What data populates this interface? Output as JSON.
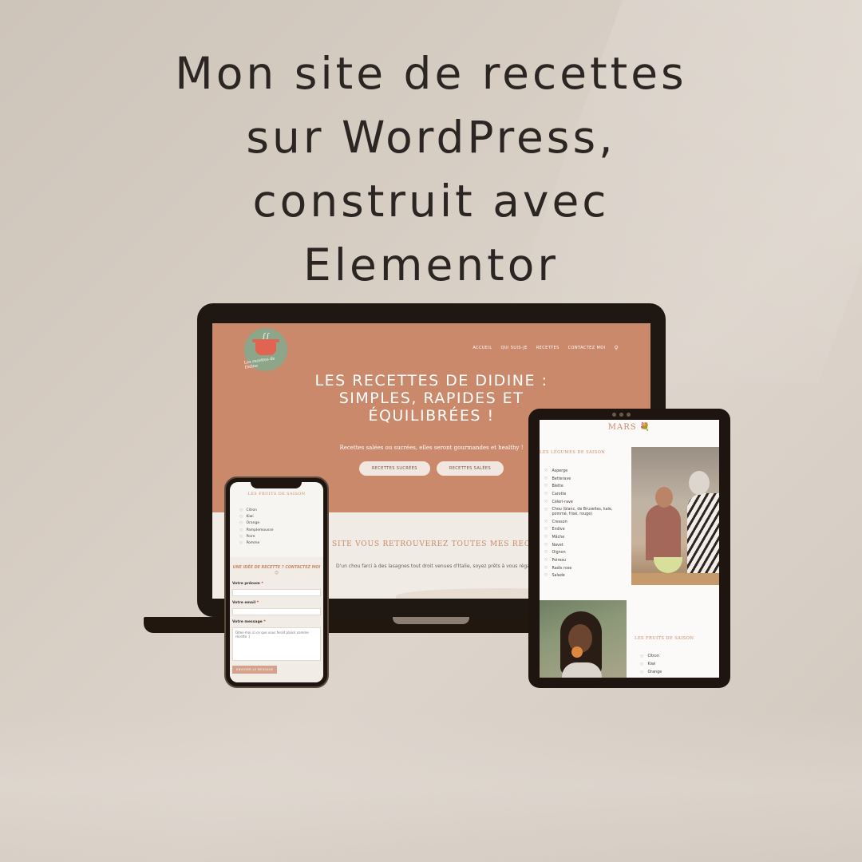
{
  "headline": {
    "line1": "Mon site de recettes",
    "line2": "sur WordPress,",
    "line3": "construit avec",
    "line4": "Elementor"
  },
  "colors": {
    "background": "#d6cdc3",
    "accent": "#c9896a",
    "logo_green": "#8da68a",
    "device_frame": "#1e1510"
  },
  "laptop": {
    "logo_label": "Les recettes de Didine",
    "nav": [
      "ACCUEIL",
      "QUI SUIS-JE",
      "RECETTES",
      "CONTACTEZ MOI"
    ],
    "search_icon": "search-icon",
    "hero_title": {
      "line1": "LES RECETTES DE DIDINE :",
      "line2": "SIMPLES, RAPIDES ET",
      "line3": "ÉQUILIBRÉES !"
    },
    "hero_subtitle": "Recettes salées ou sucrées, elles seront gourmandes et healthy !",
    "buttons": [
      "RECETTES SUCRÉES",
      "RECETTES SALÉES"
    ],
    "section_title": "SITE VOUS RETROUVEREZ TOUTES MES REC",
    "section_text": "D'un chou farci à des lasagnes tout droit venues d'Italie, soyez prêts à vous régaler !"
  },
  "phone": {
    "fruits_title": "LES FRUITS DE SAISON",
    "fruits": [
      "Citron",
      "Kiwi",
      "Orange",
      "Pamplemousse",
      "Poire",
      "Pomme"
    ],
    "contact_title": "UNE IDÉE DE RECETTE ? CONTACTEZ MOI 😊",
    "labels": {
      "first_name": "Votre prénom",
      "email": "Votre email",
      "message": "Votre message",
      "required": "*"
    },
    "message_placeholder": "Dites-moi ici ce que vous ferait plaisir comme recette :)",
    "submit": "ENVOYER LE MESSAGE"
  },
  "tablet": {
    "month": "MARS 💐",
    "vegetables_title": "LES LÉGUMES DE SAISON",
    "vegetables": [
      "Asperge",
      "Betterave",
      "Blette",
      "Carotte",
      "Céleri-rave",
      "Chou (blanc, de Bruxelles, kale, pommé, frisé, rouge)",
      "Cresson",
      "Endive",
      "Mâche",
      "Navet",
      "Oignon",
      "Poireau",
      "Radis rose",
      "Salade"
    ],
    "fruits_title": "LES FRUITS DE SAISON",
    "fruits": [
      "Citron",
      "Kiwi",
      "Orange"
    ]
  }
}
